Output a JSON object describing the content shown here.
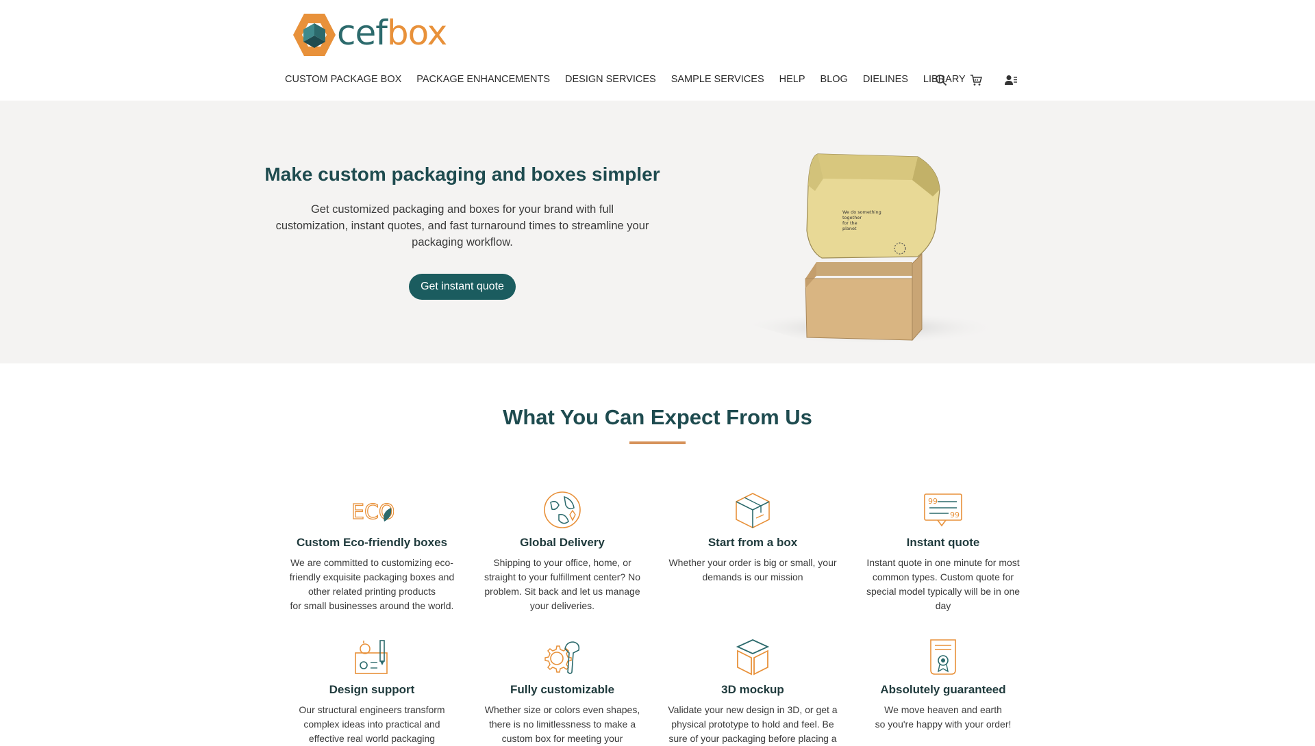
{
  "brand": {
    "name_part1": "cef",
    "name_part2": "box",
    "color_primary": "#2c6a6c",
    "color_accent": "#e8913a"
  },
  "nav": {
    "items": [
      {
        "label": "CUSTOM PACKAGE BOX"
      },
      {
        "label": "PACKAGE ENHANCEMENTS"
      },
      {
        "label": "DESIGN SERVICES"
      },
      {
        "label": "SAMPLE SERVICES"
      },
      {
        "label": "HELP"
      },
      {
        "label": "BLOG"
      },
      {
        "label": "DIELINES"
      },
      {
        "label": "LIBRARY"
      }
    ],
    "icons": [
      "search-icon",
      "cart-icon",
      "account-icon"
    ]
  },
  "hero": {
    "title": "Make custom packaging and boxes simpler",
    "subtitle": "Get customized packaging and boxes for your brand with full customization, instant quotes, and fast turnaround times to streamline your packaging workflow.",
    "cta_label": "Get instant quote",
    "cta_color": "#1b5c5f",
    "box_print": [
      "We do something",
      "together",
      "for the",
      "planet"
    ]
  },
  "features_section": {
    "title": "What You Can Expect From Us",
    "rule_color": "#d6925a",
    "items": [
      {
        "icon": "eco-leaf-icon",
        "title": "Custom Eco-friendly boxes",
        "desc": "We are committed to customizing eco-\nfriendly exquisite packaging boxes and\nother related printing products\nfor small businesses around the world."
      },
      {
        "icon": "globe-icon",
        "title": "Global Delivery",
        "desc": "Shipping to your office, home, or\nstraight to your fulfillment center? No\nproblem. Sit back and let us manage\nyour deliveries."
      },
      {
        "icon": "box-icon",
        "title": "Start from a box",
        "desc": "Whether your order is big or small, your\ndemands is our mission"
      },
      {
        "icon": "quote-icon",
        "title": "Instant quote",
        "desc": "Instant quote in one minute for most\ncommon types. Custom quote for\nspecial model typically will be in one\nday"
      },
      {
        "icon": "design-tools-icon",
        "title": "Design support",
        "desc": "Our structural engineers transform\ncomplex ideas into practical and\neffective real world packaging"
      },
      {
        "icon": "gear-wrench-icon",
        "title": "Fully customizable",
        "desc": "Whether size or colors even shapes,\nthere is no limitlessness to make a\ncustom box for meeting your"
      },
      {
        "icon": "cube-3d-icon",
        "title": "3D mockup",
        "desc": "Validate your new design in 3D, or get a\nphysical prototype to hold and feel. Be\nsure of your packaging before placing a"
      },
      {
        "icon": "certificate-icon",
        "title": "Absolutely guaranteed",
        "desc": "We move heaven and earth\nso you're happy with your order!"
      }
    ]
  }
}
